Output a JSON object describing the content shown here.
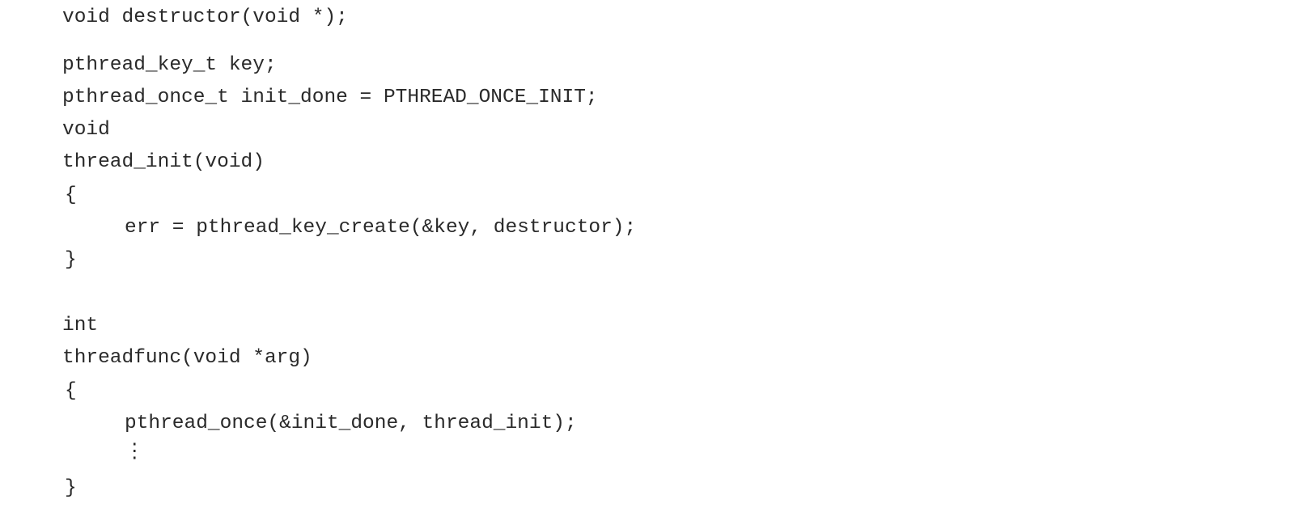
{
  "code": {
    "lines": [
      "void destructor(void *);",
      "pthread_key_t key;",
      "pthread_once_t init_done = PTHREAD_ONCE_INIT;",
      "void",
      "thread_init(void)",
      "{",
      "err = pthread_key_create(&key, destructor);",
      "}",
      "int",
      "threadfunc(void *arg)",
      "{",
      "pthread_once(&init_done, thread_init);",
      "⋮",
      "}"
    ]
  }
}
